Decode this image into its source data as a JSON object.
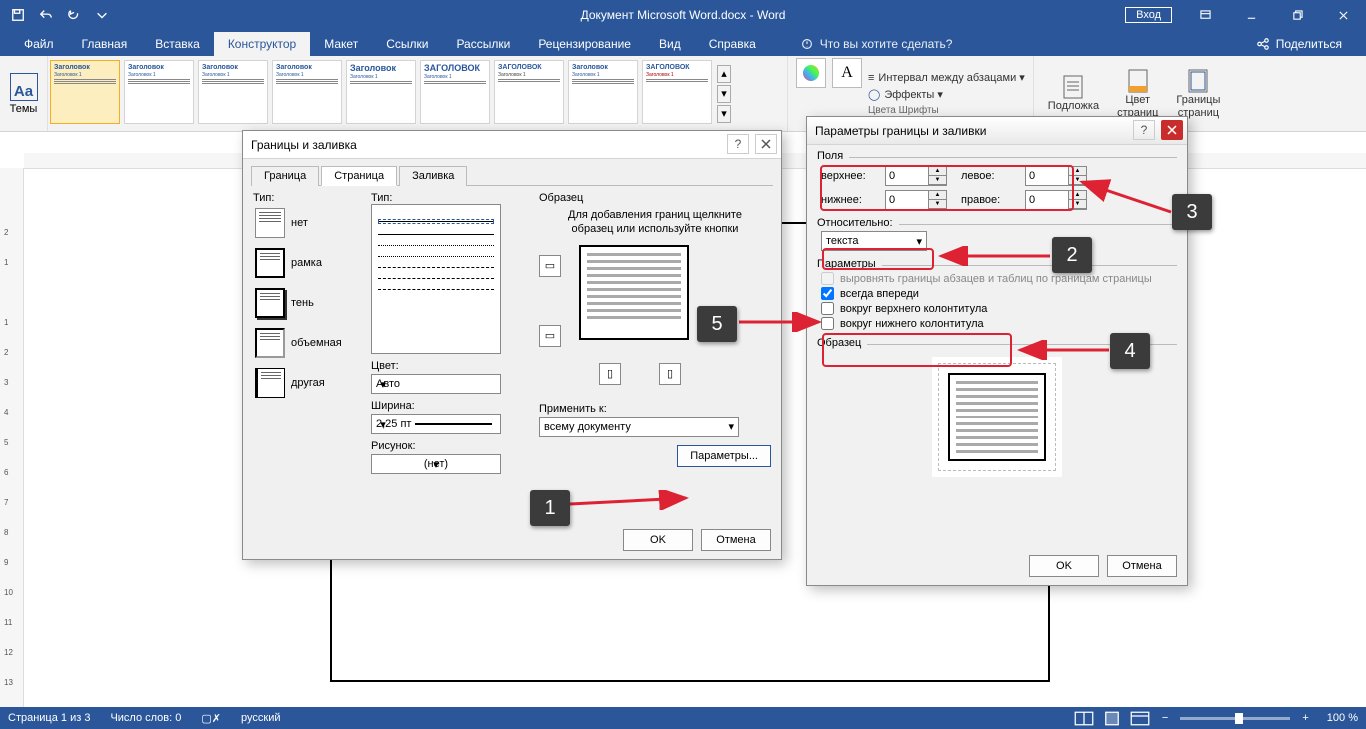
{
  "title": "Документ Microsoft Word.docx - Word",
  "titlebar": {
    "login": "Вход"
  },
  "tabs": {
    "file": "Файл",
    "home": "Главная",
    "insert": "Вставка",
    "design": "Конструктор",
    "layout": "Макет",
    "references": "Ссылки",
    "mailings": "Рассылки",
    "review": "Рецензирование",
    "view": "Вид",
    "help": "Справка",
    "tell": "Что вы хотите сделать?",
    "share": "Поделиться"
  },
  "ribbon": {
    "themes": "Темы",
    "gallery_title_variants": [
      "Заголовок",
      "Заголовок",
      "Заголовок",
      "Заголовок",
      "Заголовок",
      "ЗАГОЛОВОК",
      "ЗАГОЛОВОК",
      "Заголовок",
      "ЗАГОЛОВОК"
    ],
    "gallery_sub": "Заголовок 1",
    "spacing": "Интервал между абзацами ▾",
    "effects": "Эффекты ▾",
    "colors_fonts": "Цвета  Шрифты",
    "a_label": "A",
    "watermark": "Подложка",
    "pagecolor": "Цвет\nстраниц",
    "pageborders": "Границы\nстраниц"
  },
  "dlg1": {
    "title": "Границы и заливка",
    "tabs": {
      "border": "Граница",
      "page": "Страница",
      "shading": "Заливка"
    },
    "type_label": "Тип:",
    "types": {
      "none": "нет",
      "box": "рамка",
      "shadow": "тень",
      "threed": "объемная",
      "custom": "другая"
    },
    "style_label": "Тип:",
    "color_label": "Цвет:",
    "color_value": "Авто",
    "width_label": "Ширина:",
    "width_value": "2,25 пт",
    "art_label": "Рисунок:",
    "art_value": "(нет)",
    "preview_label": "Образец",
    "preview_hint": "Для добавления границ щелкните образец или используйте кнопки",
    "apply_label": "Применить к:",
    "apply_value": "всему документу",
    "options_btn": "Параметры...",
    "ok": "OK",
    "cancel": "Отмена"
  },
  "dlg2": {
    "title": "Параметры границы и заливки",
    "fields_label": "Поля",
    "top": "верхнее:",
    "bottom": "нижнее:",
    "left": "левое:",
    "right": "правое:",
    "val_top": "0",
    "val_bottom": "0",
    "val_left": "0",
    "val_right": "0",
    "relative_label": "Относительно:",
    "relative_value": "текста",
    "params_label": "Параметры",
    "chk_align": "выровнять границы абзацев и таблиц по границам страницы",
    "chk_front": "всегда впереди",
    "chk_header": "вокруг верхнего колонтитула",
    "chk_footer": "вокруг нижнего колонтитула",
    "preview_label": "Образец",
    "ok": "OK",
    "cancel": "Отмена"
  },
  "callouts": {
    "c1": "1",
    "c2": "2",
    "c3": "3",
    "c4": "4",
    "c5": "5"
  },
  "status": {
    "page": "Страница 1 из 3",
    "words": "Число слов: 0",
    "lang": "русский",
    "zoom": "100 %"
  }
}
